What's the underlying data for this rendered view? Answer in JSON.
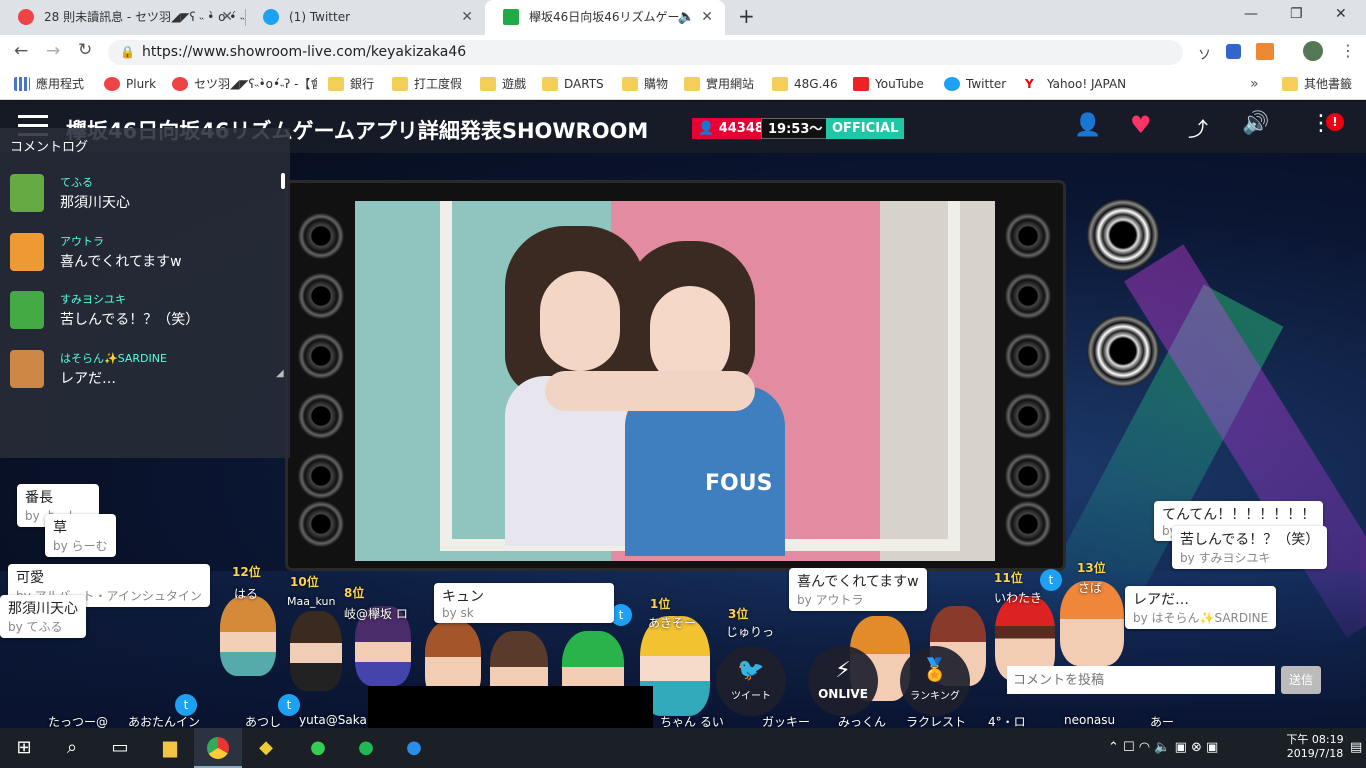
{
  "browser": {
    "tabs": [
      {
        "title": "28 則未讀訊息 - セツ羽◢◤ʕ ˵ •̀ o •́ ˵ ʔ",
        "active": false,
        "fav": "#e44"
      },
      {
        "title": "(1) Twitter",
        "active": false,
        "fav": "#1da1f2"
      },
      {
        "title": "欅坂46日向坂46リズムゲー",
        "active": true,
        "fav": "#2a4"
      }
    ],
    "new_tab": "+",
    "url": "https://www.showroom-live.com/keyakizaka46",
    "bookmarks": [
      "應用程式",
      "Plurk",
      "セツ羽◢◤ʕ˵•̀o•́˵ʔ -【會…",
      "銀行",
      "打工度假",
      "遊戲",
      "DARTS",
      "購物",
      "實用網站",
      "48G.46",
      "YouTube",
      "Twitter",
      "Yahoo! JAPAN",
      "其他書籤"
    ],
    "window_controls": {
      "minimize": "—",
      "maximize": "❐",
      "close": "✕"
    }
  },
  "room": {
    "title": "欅坂46日向坂46リズムゲームアプリ詳細発表SHOWROOM",
    "viewers": "44348",
    "time": "19:53〜",
    "official": "OFFICIAL",
    "alert": "!"
  },
  "comment_log": {
    "title": "コメントログ",
    "entries": [
      {
        "name": "てふる",
        "text": "那須川天心",
        "color": "#6a4"
      },
      {
        "name": "アウトラ",
        "text": "喜んでくれてますw",
        "color": "#e93"
      },
      {
        "name": "すみヨシユキ",
        "text": "苦しんでる！？（笑）",
        "color": "#4a4"
      },
      {
        "name": "はそらん✨SARDINE",
        "text": "レアだ…",
        "color": "#c84"
      }
    ]
  },
  "bubbles": [
    {
      "text": "番長",
      "by": "by よっしー"
    },
    {
      "text": "草",
      "by": "by らーむ"
    },
    {
      "text": "可愛",
      "by": "by アルバート・アインシュタイン"
    },
    {
      "text": "那須川天心",
      "by": "by てふる"
    },
    {
      "text": "キュン",
      "by": "by sk"
    },
    {
      "text": "喜んでくれてますw",
      "by": "by アウトラ"
    },
    {
      "text": "てんてん！！！！！！！",
      "by": "by"
    },
    {
      "text": "苦しんでる！？（笑）",
      "by": "by すみヨシユキ"
    },
    {
      "text": "レアだ…",
      "by": "by はそらん✨SARDINE"
    }
  ],
  "ranks": [
    {
      "rank": "12位",
      "name": "はる"
    },
    {
      "rank": "10位",
      "name": "Maa_kun"
    },
    {
      "rank": "8位",
      "name": "岐@欅坂 ロ"
    },
    {
      "rank": "1位",
      "name": "あきそー"
    },
    {
      "rank": "3位",
      "name": "じゅりっ"
    },
    {
      "rank": "11位",
      "name": "いわたき"
    },
    {
      "rank": "13位",
      "name": "さば"
    }
  ],
  "bottom_names": [
    "たっつー@",
    "あおたんイン",
    "あつし",
    "yuta@Saka",
    "ちゃん るい",
    "ガッキー",
    "みっくん",
    "ラクレスト",
    "4°・ロ",
    "neonasu",
    "あー"
  ],
  "controls": {
    "tweet": "ツイート",
    "onlive": "ONLIVE",
    "ranking": "ランキング"
  },
  "comment_input": {
    "placeholder": "コメントを投稿",
    "send": "送信"
  },
  "taskbar": {
    "time": "下午 08:19",
    "date": "2019/7/18"
  }
}
